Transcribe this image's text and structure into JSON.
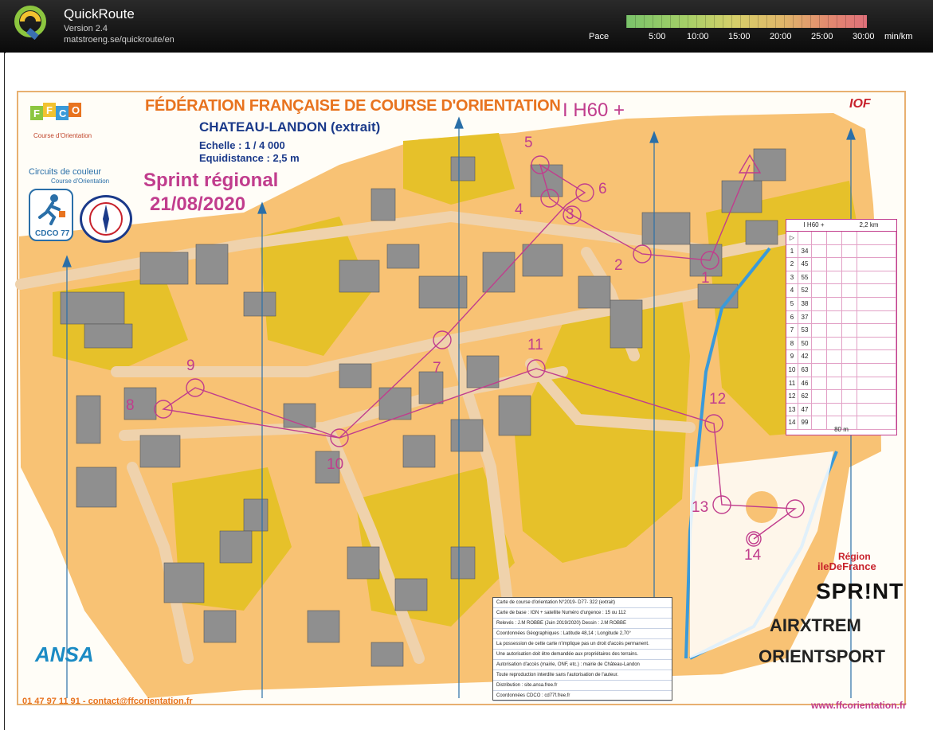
{
  "app": {
    "title": "QuickRoute",
    "version": "Version 2.4",
    "url": "matstroeng.se/quickroute/en"
  },
  "pace": {
    "label": "Pace",
    "ticks": [
      "5:00",
      "10:00",
      "15:00",
      "20:00",
      "25:00",
      "30:00"
    ],
    "unit": "min/km",
    "gradient_colors": [
      "#7ac36a",
      "#a5cf67",
      "#d6cf6a",
      "#e0b66a",
      "#e28870",
      "#e0707a"
    ]
  },
  "map": {
    "federation": "FÉDÉRATION FRANÇAISE DE COURSE D'ORIENTATION",
    "name": "CHATEAU-LANDON (extrait)",
    "scale": "Echelle : 1 / 4 000",
    "equidistance": "Equidistance : 2,5 m",
    "event": "Sprint régional",
    "date": "21/08/2020",
    "class": "I H60 +",
    "phone": "01 47 97 11 91 - contact@ffcorientation.fr",
    "website": "www.ffcorientation.fr",
    "colors": {
      "open_land": "#f8c274",
      "rough": "#e7c32a",
      "buildings": "#8f8f8f",
      "paved": "#efd2ac",
      "course": "#c13d8d",
      "water": "#3a9ad9"
    },
    "controls": [
      "1",
      "2",
      "3",
      "4",
      "5",
      "6",
      "7",
      "8",
      "9",
      "10",
      "11",
      "12",
      "13",
      "14"
    ]
  },
  "logos": {
    "ffco": "FFCO",
    "ffco_sub": "Course d'Orientation",
    "circuits": "Circuits de couleur",
    "circuits_sub": "Course d'Orientation",
    "cdco": "CDCO",
    "cdco_num": "77",
    "iof": "IOF",
    "region_line1": "Région",
    "region_line2": "ileDeFrance",
    "sprint": "SPR!NT",
    "airxtrem": "AIRXTREM",
    "orientsport": "ORIENTSPORT",
    "ansa": "ANSA"
  },
  "description_sheet": {
    "header": [
      "I H60 +",
      "2,2 km"
    ],
    "rows": [
      {
        "n": "1",
        "code": "34"
      },
      {
        "n": "2",
        "code": "45"
      },
      {
        "n": "3",
        "code": "55"
      },
      {
        "n": "4",
        "code": "52"
      },
      {
        "n": "5",
        "code": "38"
      },
      {
        "n": "6",
        "code": "37"
      },
      {
        "n": "7",
        "code": "53"
      },
      {
        "n": "8",
        "code": "50"
      },
      {
        "n": "9",
        "code": "42"
      },
      {
        "n": "10",
        "code": "63"
      },
      {
        "n": "11",
        "code": "46"
      },
      {
        "n": "12",
        "code": "62"
      },
      {
        "n": "13",
        "code": "47"
      },
      {
        "n": "14",
        "code": "99"
      }
    ],
    "footer": "80 m"
  },
  "info_box": {
    "lines": [
      "Carte de course d'orientation N°2019- D77- 322 (extrait)",
      "Carte de base : IGN + satellite   Numéro d'urgence : 15 ou 112",
      "Relevés : J.M ROBBE (Juin 2019/2020)   Dessin : J.M ROBBE",
      "Coordonnées Géographiques : Latitude 48,14 ; Longitude 2,70°",
      "La possession de cette carte n'implique pas un droit d'accès permanent.",
      "Une autorisation doit être demandée aux propriétaires des terrains.",
      "Autorisation d'accès (mairie, ONF, etc.) : mairie de Château-Landon",
      "Toute reproduction interdite sans l'autorisation de l'auteur.",
      "Distribution : site.ansa.free.fr",
      "Coordonnées CDCO : cd77f.free.fr"
    ]
  }
}
